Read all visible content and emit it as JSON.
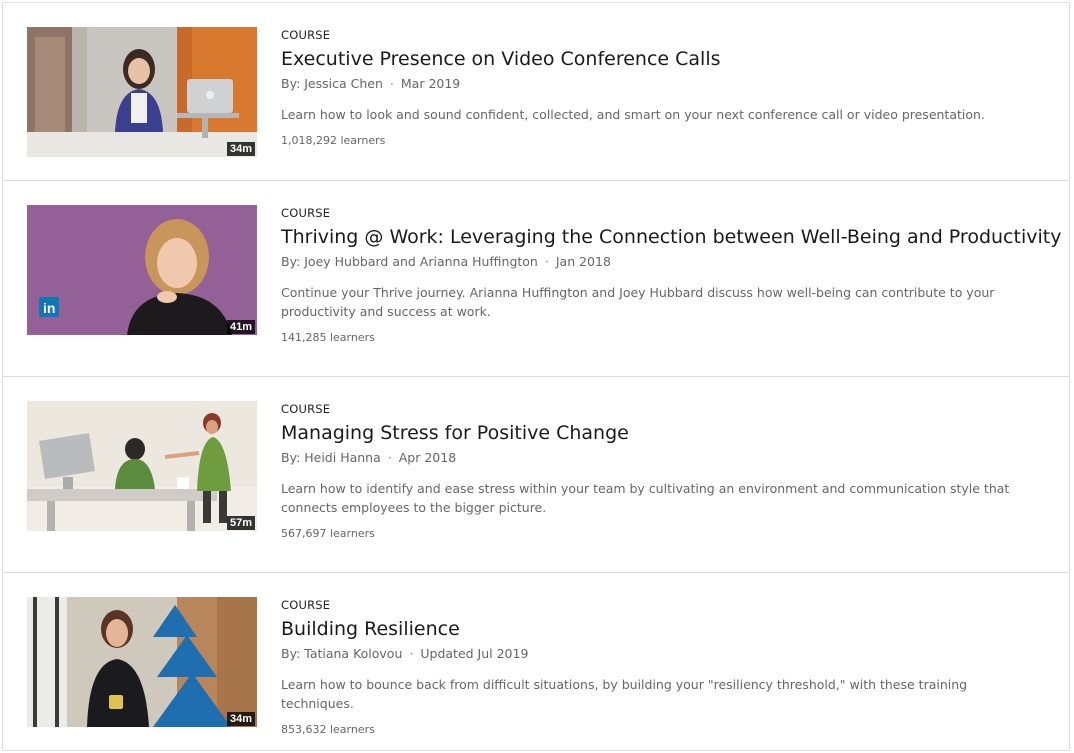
{
  "courses": [
    {
      "kind": "COURSE",
      "title": "Executive Presence on Video Conference Calls",
      "author": "By: Jessica Chen",
      "date": "Mar 2019",
      "description": "Learn how to look and sound confident, collected, and smart on your next conference call or video presentation.",
      "learners": "1,018,292 learners",
      "duration": "34m",
      "thumbnail": "woman-at-laptop-image"
    },
    {
      "kind": "COURSE",
      "title": "Thriving @ Work: Leveraging the Connection between Well-Being and Productivity",
      "author": "By: Joey Hubbard and Arianna Huffington",
      "date": "Jan 2018",
      "description": "Continue your Thrive journey. Arianna Huffington and Joey Hubbard discuss how well-being can contribute to your productivity and success at work.",
      "learners": "141,285 learners",
      "duration": "41m",
      "thumbnail": "woman-portrait-purple-image",
      "badge": "in"
    },
    {
      "kind": "COURSE",
      "title": "Managing Stress for Positive Change",
      "author": "By: Heidi Hanna",
      "date": "Apr 2018",
      "description": "Learn how to identify and ease stress within your team by cultivating an environment and communication style that connects employees to the bigger picture.",
      "learners": "567,697 learners",
      "duration": "57m",
      "thumbnail": "stressed-worker-illustration"
    },
    {
      "kind": "COURSE",
      "title": "Building Resilience",
      "author": "By: Tatiana Kolovou",
      "date": "Updated Jul 2019",
      "description": "Learn how to bounce back from difficult situations, by building your \"resiliency threshold,\" with these training techniques.",
      "learners": "853,632 learners",
      "duration": "34m",
      "thumbnail": "woman-with-mug-image"
    }
  ]
}
